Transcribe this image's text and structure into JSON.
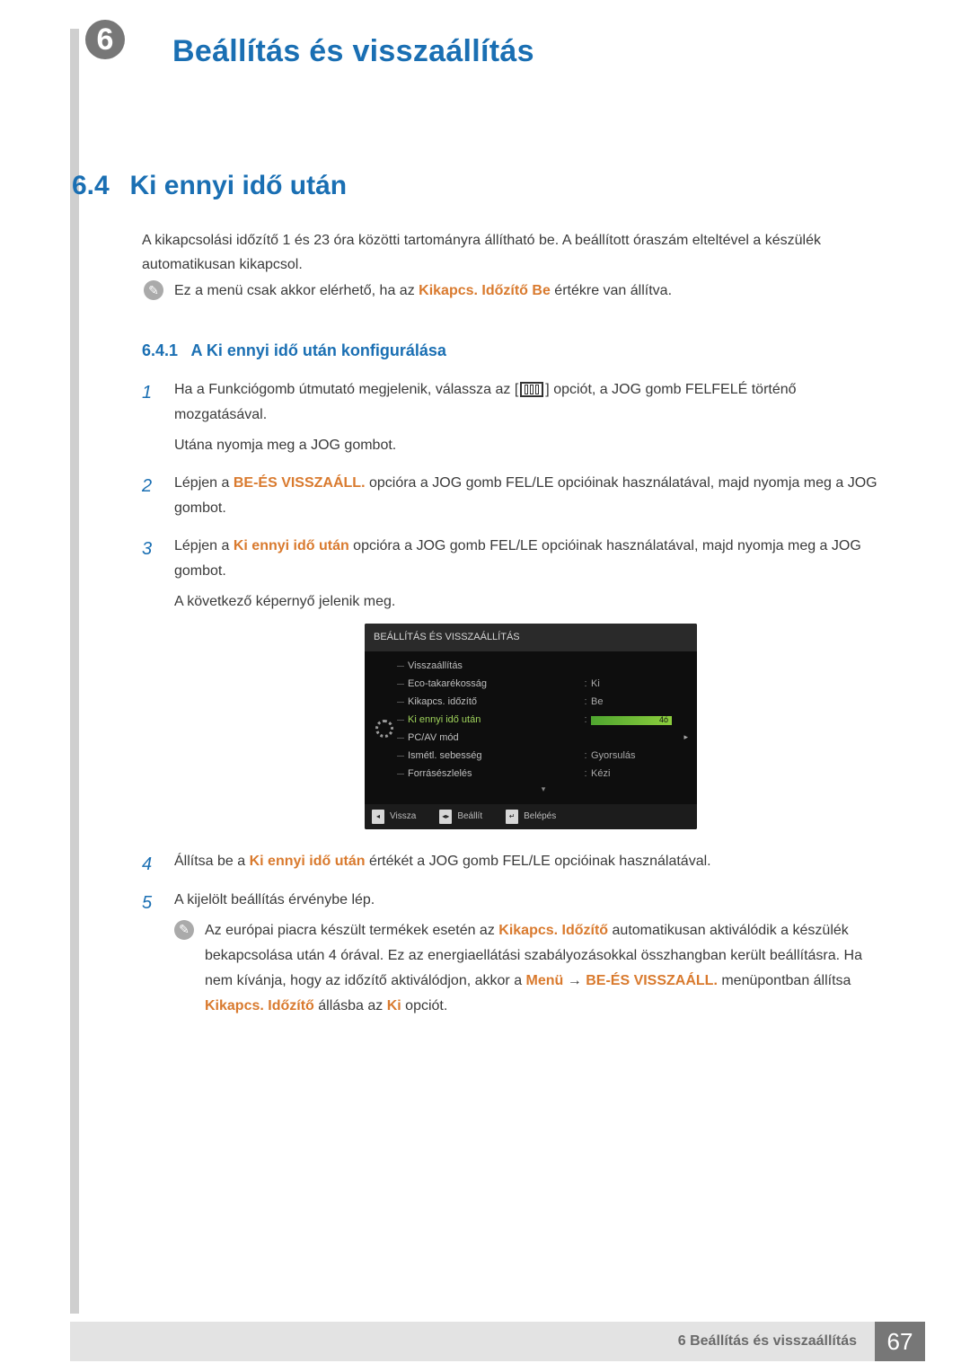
{
  "chapter": {
    "num": "6",
    "title": "Beállítás és visszaállítás"
  },
  "section": {
    "num": "6.4",
    "title": "Ki ennyi idő után"
  },
  "intro": "A kikapcsolási időzítő 1 és 23 óra közötti tartományra állítható be. A beállított óraszám elteltével a készülék automatikusan kikapcsol.",
  "note1": {
    "before": "Ez a menü csak akkor elérhető, ha az ",
    "bold": "Kikapcs. Időzítő Be",
    "after": " értékre van állítva."
  },
  "subsection": {
    "num": "6.4.1",
    "title": "A Ki ennyi idő után konfigurálása"
  },
  "steps": {
    "s1": {
      "num": "1",
      "a": "Ha a Funkciógomb útmutató megjelenik, válassza az [",
      "b": "] opciót, a JOG gomb FELFELÉ történő mozgatásával.",
      "c": "Utána nyomja meg a JOG gombot."
    },
    "s2": {
      "num": "2",
      "a": "Lépjen a ",
      "bold": "BE-ÉS VISSZAÁLL.",
      "b": " opcióra a JOG gomb FEL/LE opcióinak használatával, majd nyomja meg a JOG gombot."
    },
    "s3": {
      "num": "3",
      "a": "Lépjen a ",
      "bold": "Ki ennyi idő után",
      "b": " opcióra a JOG gomb FEL/LE opcióinak használatával, majd nyomja meg a JOG gombot.",
      "c": "A következő képernyő jelenik meg."
    },
    "s4": {
      "num": "4",
      "a": "Állítsa be a ",
      "bold": "Ki ennyi idő után",
      "b": " értékét a JOG gomb FEL/LE opcióinak használatával."
    },
    "s5": {
      "num": "5",
      "a": "A kijelölt beállítás érvénybe lép."
    }
  },
  "osd": {
    "title": "BEÁLLÍTÁS ÉS VISSZAÁLLÍTÁS",
    "rows": {
      "r1": {
        "label": "Visszaállítás"
      },
      "r2": {
        "label": "Eco-takarékosság",
        "val": "Ki"
      },
      "r3": {
        "label": "Kikapcs. időzítő",
        "val": "Be"
      },
      "r4": {
        "label": "Ki ennyi idő után",
        "barval": "4ó"
      },
      "r5": {
        "label": "PC/AV mód"
      },
      "r6": {
        "label": "Ismétl. sebesség",
        "val": "Gyorsulás"
      },
      "r7": {
        "label": "Forrásészlelés",
        "val": "Kézi"
      }
    },
    "footer": {
      "back": "Vissza",
      "set": "Beállít",
      "enter": "Belépés"
    }
  },
  "note2": {
    "a": "Az európai piacra készült termékek esetén az ",
    "bold1": "Kikapcs. Időzítő",
    "b": " automatikusan aktiválódik a készülék bekapcsolása után 4 órával. Ez az energiaellátási szabályozásokkal összhangban került beállításra. Ha nem kívánja, hogy az időzítő aktiválódjon, akkor a ",
    "bold2": "Menü",
    "arrow": "→",
    "bold3": "BE-ÉS VISSZAÁLL.",
    "c": " menüpontban állítsa ",
    "bold4": "Kikapcs. Időzítő",
    "d": " állásba az ",
    "bold5": "Ki",
    "e": " opciót."
  },
  "footer": {
    "label": "6 Beállítás és visszaállítás",
    "page": "67"
  }
}
